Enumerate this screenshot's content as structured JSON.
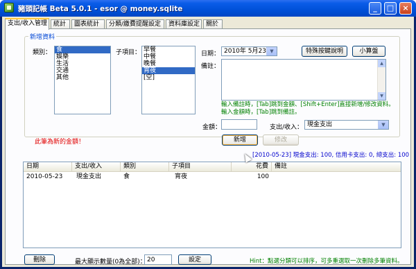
{
  "window": {
    "title": "豬頭記帳 Beta 5.0.1 - esor @ money.sqlite",
    "minimize_glyph": "_",
    "maximize_glyph": "□",
    "close_glyph": "×"
  },
  "tabs": [
    {
      "label": "支出/收入管理",
      "active": true
    },
    {
      "label": "統計"
    },
    {
      "label": "圖表統計"
    },
    {
      "label": "分類/繳費提醒設定"
    },
    {
      "label": "資料庫設定"
    },
    {
      "label": "關於"
    }
  ],
  "new_entry": {
    "group_title": "新增資料",
    "category_label": "類別：",
    "categories": [
      "食",
      "娛樂",
      "生活",
      "交通",
      "其他"
    ],
    "selected_category": "食",
    "subitem_label": "子項目：",
    "subitems": [
      "早餐",
      "中餐",
      "晚餐",
      "宵夜",
      "[空]"
    ],
    "selected_subitem": "宵夜",
    "date_label": "日期：",
    "date_value": "2010年 5月23日",
    "special_keys_button": "特殊按鍵說明",
    "calculator_button": "小算盤",
    "note_label": "備註：",
    "note_value": "",
    "hint_line1": "輸入備註時，[Tab]跳到金額、[Shift+Enter]直接新增/修改資料。",
    "hint_line2": "輸入金額時，[Tab]跳到備註。",
    "amount_label": "金額：",
    "amount_value": "",
    "type_label": "支出/收入：",
    "type_value": "現金支出",
    "new_warning": "此筆為新的金額！",
    "add_button": "新增",
    "edit_button": "修改"
  },
  "summary": "[2010-05-23] 現金支出: 100, 信用卡支出: 0, 總支出: 100",
  "grid": {
    "columns": [
      "日期",
      "支出/收入",
      "類別",
      "子項目",
      "花費",
      "備註"
    ],
    "rows": [
      {
        "date": "2010-05-23",
        "type": "現金支出",
        "category": "食",
        "subitem": "宵夜",
        "cost": "100",
        "note": ""
      }
    ]
  },
  "footer": {
    "delete_button": "刪除",
    "max_rows_label": "最大顯示數量(0為全部)：",
    "max_rows_value": "20",
    "set_button": "設定",
    "hint": "Hint：點選分類可以排序，可多重選取一次刪除多筆資料。"
  },
  "colors": {
    "selection": "#316ac5",
    "hint_green": "#008000",
    "warning_red": "#e00000",
    "summary_blue": "#0000cc",
    "group_title_blue": "#0046d5"
  }
}
